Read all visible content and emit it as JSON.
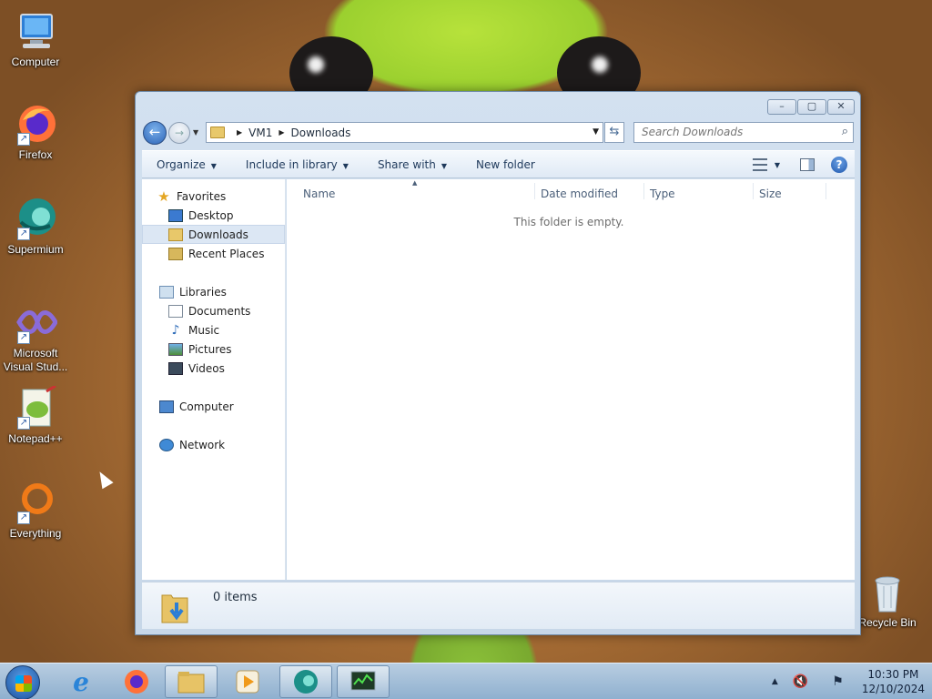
{
  "desktop": {
    "icons": [
      {
        "label": "Computer",
        "icon": "computer-icon"
      },
      {
        "label": "Firefox",
        "icon": "firefox-icon"
      },
      {
        "label": "Supermium",
        "icon": "supermium-icon"
      },
      {
        "label": "Microsoft Visual Stud...",
        "icon": "visual-studio-icon"
      },
      {
        "label": "Notepad++",
        "icon": "notepadpp-icon"
      },
      {
        "label": "Everything",
        "icon": "everything-icon"
      },
      {
        "label": "Recycle Bin",
        "icon": "recycle-bin-icon"
      }
    ]
  },
  "window": {
    "buttons": {
      "minimize": "–",
      "maximize": "▢",
      "close": "✕"
    },
    "address": {
      "crumbs": [
        "VM1",
        "Downloads"
      ],
      "search_placeholder": "Search Downloads"
    },
    "toolbar": {
      "organize": "Organize",
      "include": "Include in library",
      "share": "Share with",
      "new_folder": "New folder"
    },
    "nav": {
      "favorites": "Favorites",
      "desktop": "Desktop",
      "downloads": "Downloads",
      "recent": "Recent Places",
      "libraries": "Libraries",
      "documents": "Documents",
      "music": "Music",
      "pictures": "Pictures",
      "videos": "Videos",
      "computer": "Computer",
      "network": "Network"
    },
    "columns": {
      "name": "Name",
      "date": "Date modified",
      "type": "Type",
      "size": "Size"
    },
    "empty_message": "This folder is empty.",
    "details": {
      "count": "0 items"
    }
  },
  "taskbar": {
    "clock": {
      "time": "10:30 PM",
      "date": "12/10/2024"
    }
  },
  "colors": {
    "accent": "#1e395b",
    "selection": "#dce7f4",
    "taskbar": "#9fbcd8"
  }
}
